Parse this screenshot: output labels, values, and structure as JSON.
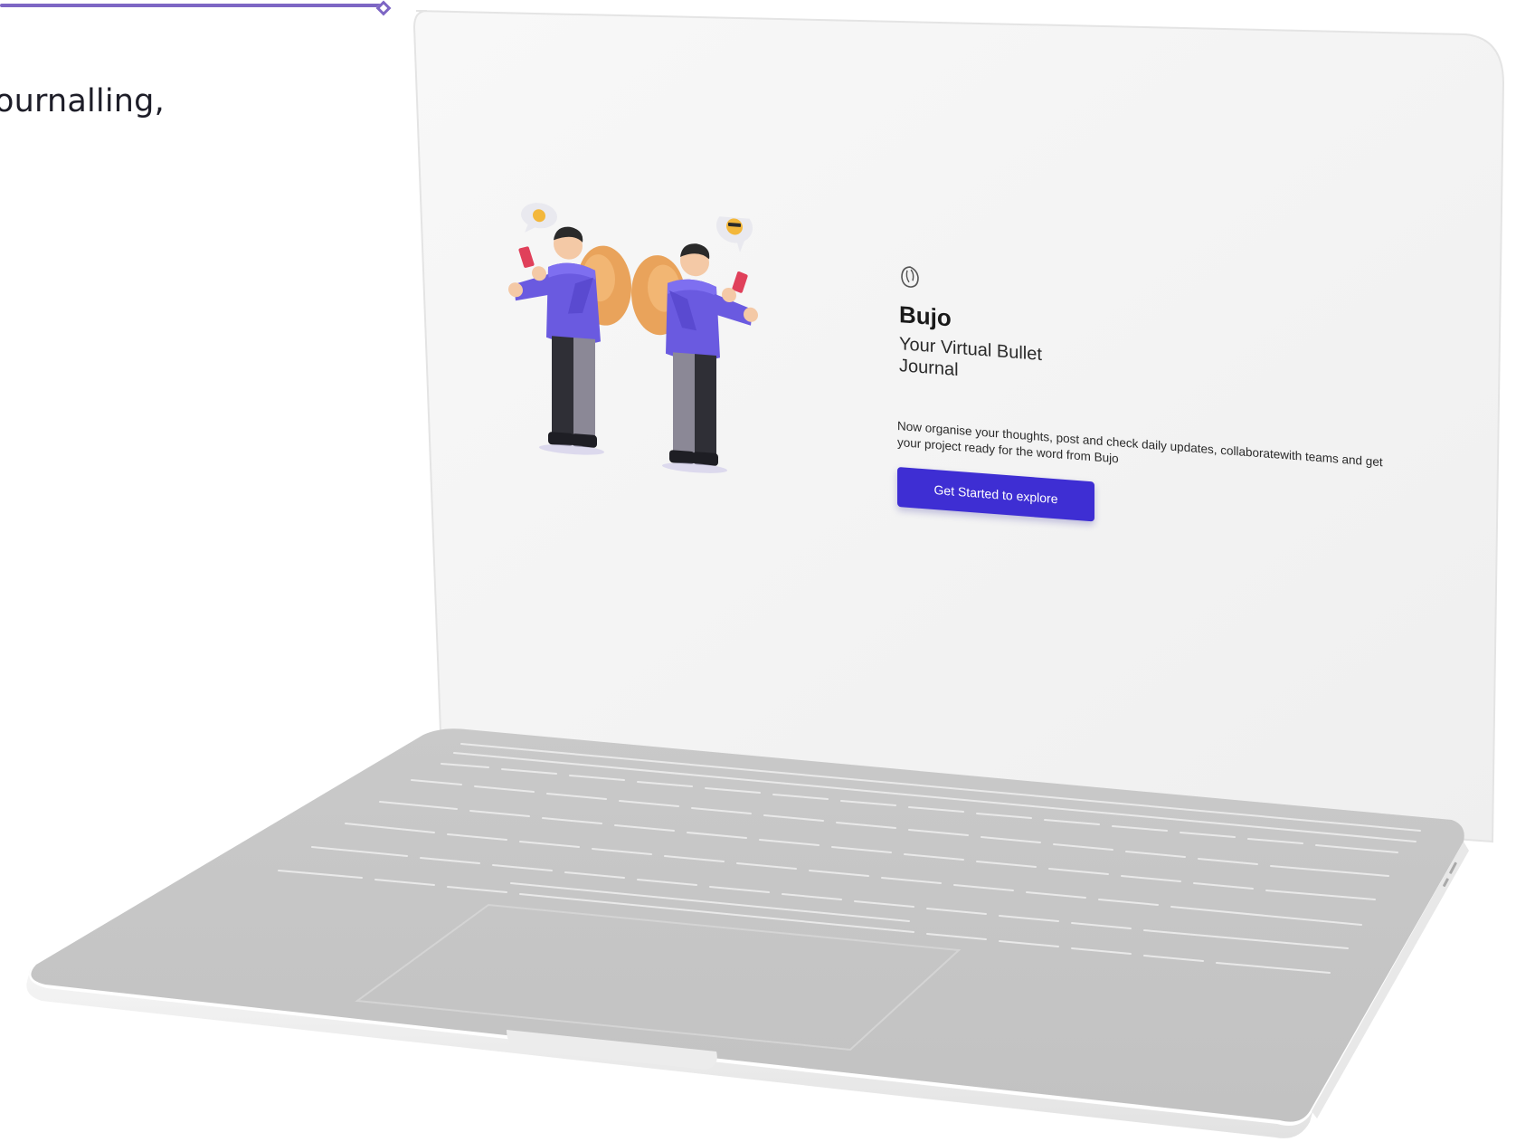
{
  "side_panel": {
    "text": "ournalling,"
  },
  "app": {
    "brand_name": "Bujo",
    "tagline": "Your Virtual Bullet Journal",
    "description": "Now organise your thoughts, post and check daily updates, collaboratewith teams and get your project ready for the word from Bujo",
    "cta_label": "Get Started to explore"
  },
  "colors": {
    "accent": "#3e2ed3",
    "divider": "#7d66c4",
    "screen_bg": "#f7f7f7",
    "laptop_body": "#c6c6c6"
  },
  "icons": {
    "logo": "bujo-logo-icon"
  }
}
